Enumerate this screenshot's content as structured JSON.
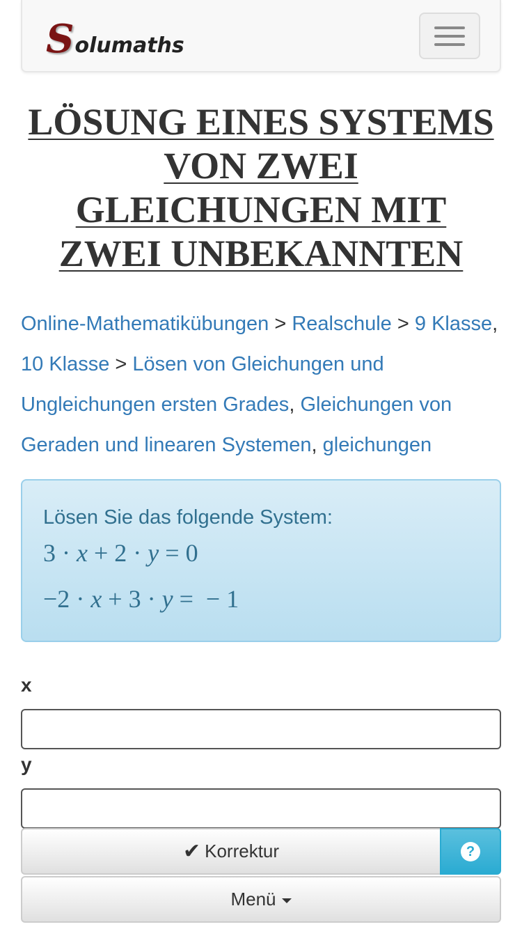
{
  "brand": {
    "logo_initial": "S",
    "logo_rest": "olumaths",
    "logo_color": "#7a1414"
  },
  "title": "LÖSUNG EINES SYSTEMS VON ZWEI GLEICHUNGEN MIT ZWEI UNBEKANNTEN",
  "breadcrumb": {
    "link_1": "Online-Mathematikübungen",
    "sep_1": " > ",
    "link_2": "Realschule",
    "sep_2": " > ",
    "link_3": "9 Klasse",
    "sep_3": ", ",
    "link_4": "10 Klasse",
    "sep_4": " > ",
    "link_5": "Lösen von Gleichungen und Ungleichungen ersten Grades",
    "sep_5": ", ",
    "link_6": "Gleichungen von Geraden und linearen Systemen",
    "sep_6": ", ",
    "link_7": "gleichungen",
    "link_color": "#337ab7"
  },
  "exercise": {
    "prompt": "Lösen Sie das folgende System:",
    "equation_1": {
      "a": "3",
      "op1": " · ",
      "var1": "x",
      "plus": " + ",
      "b": "2",
      "op2": " · ",
      "var2": "y",
      "rest": " = 0"
    },
    "equation_2": {
      "a": "−2",
      "op1": " · ",
      "var1": "x",
      "plus": " + ",
      "b": "3",
      "op2": " · ",
      "var2": "y",
      "rest": " =  − 1"
    },
    "background_color": "#d9edf7"
  },
  "form": {
    "x_label": "x",
    "x_value": "",
    "y_label": "y",
    "y_value": ""
  },
  "buttons": {
    "correct_label": "Korrektur",
    "help_symbol": "?",
    "menu_label": "Menü",
    "help_color": "#5bc0de"
  },
  "icons": {
    "menu": "hamburger-menu-icon",
    "check": "check-icon",
    "help": "question-circle-icon",
    "caret": "caret-down-icon"
  }
}
